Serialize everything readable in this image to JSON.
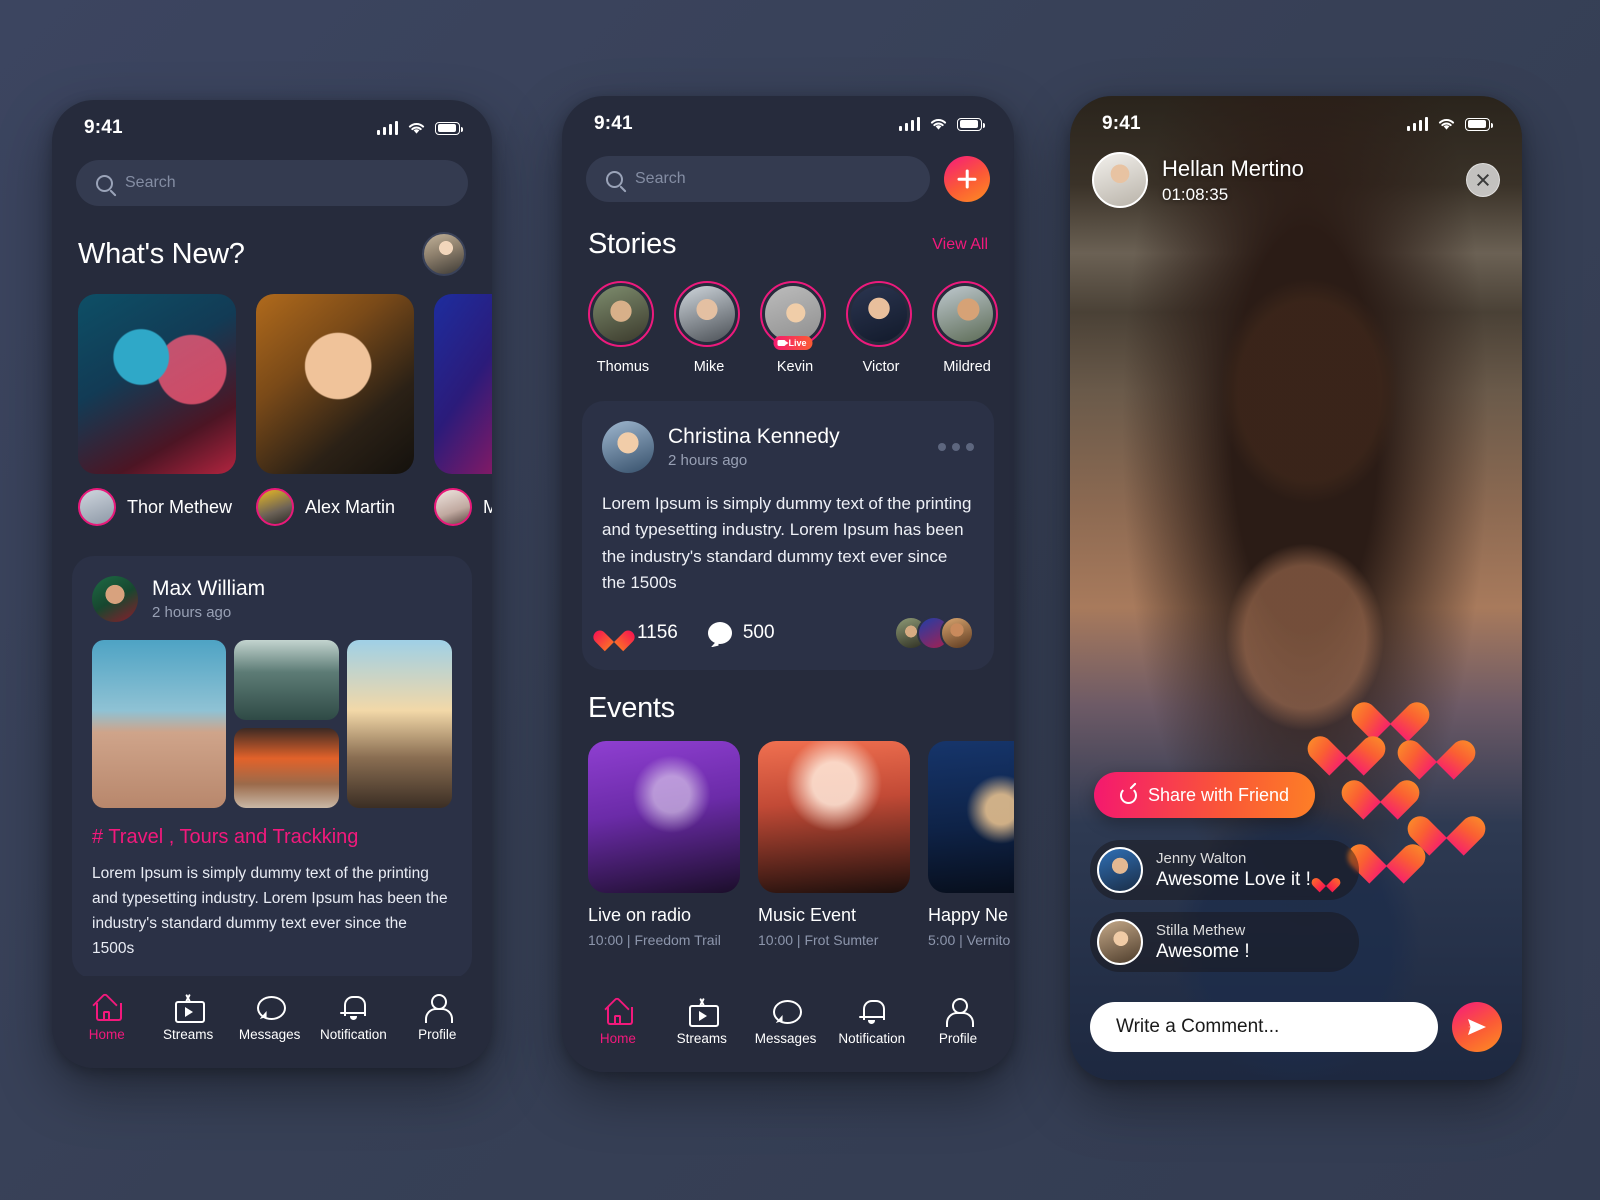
{
  "theme": {
    "page_bg": "#374056",
    "phone_bg": "#262b3c",
    "card_bg": "#2b3146",
    "accent_pink": "#f2197c",
    "accent_orange": "#fd8f22",
    "text_primary": "#ffffff",
    "text_muted": "#98a0b4"
  },
  "status_bar": {
    "time": "9:41",
    "signal_icon": "cellular-bars-icon",
    "wifi_icon": "wifi-icon",
    "battery_icon": "battery-icon"
  },
  "screen1": {
    "search": {
      "placeholder": "Search",
      "value": "",
      "icon": "search-icon"
    },
    "section_title": "What's New?",
    "profile_avatar": "user-avatar",
    "whats_new": [
      {
        "name": "Thor Methew"
      },
      {
        "name": "Alex Martin"
      },
      {
        "name": "Mon"
      }
    ],
    "post": {
      "author": "Max William",
      "time": "2 hours ago",
      "hashtag": "# Travel , Tours and Trackking",
      "body": "Lorem Ipsum is simply dummy text of the printing and typesetting industry. Lorem Ipsum has been the industry's standard dummy text ever since the 1500s",
      "photo_count": 4
    },
    "bottom_nav": [
      {
        "label": "Home",
        "icon": "home-icon",
        "active": true
      },
      {
        "label": "Streams",
        "icon": "tv-icon",
        "active": false
      },
      {
        "label": "Messages",
        "icon": "chat-icon",
        "active": false
      },
      {
        "label": "Notification",
        "icon": "bell-icon",
        "active": false
      },
      {
        "label": "Profile",
        "icon": "user-icon",
        "active": false
      }
    ]
  },
  "screen2": {
    "search": {
      "placeholder": "Search",
      "value": "",
      "icon": "search-icon"
    },
    "add_button": {
      "icon": "plus-icon",
      "label": ""
    },
    "stories_title": "Stories",
    "view_all": "View All",
    "stories": [
      {
        "name": "Thomus",
        "live": false
      },
      {
        "name": "Mike",
        "live": false
      },
      {
        "name": "Kevin",
        "live": true,
        "live_label": "Live"
      },
      {
        "name": "Victor",
        "live": false
      },
      {
        "name": "Mildred",
        "live": false
      },
      {
        "name": "",
        "live": false
      }
    ],
    "post": {
      "author": "Christina Kennedy",
      "time": "2 hours ago",
      "body": "Lorem Ipsum is simply dummy text of the printing and typesetting industry. Lorem Ipsum has been the industry's standard dummy text ever since the 1500s",
      "likes": "1156",
      "comments": "500",
      "menu_icon": "more-options-icon",
      "like_icon": "heart-icon",
      "comment_icon": "comment-bubble-icon"
    },
    "events_title": "Events",
    "events": [
      {
        "title": "Live on radio",
        "meta": "10:00 | Freedom Trail"
      },
      {
        "title": "Music Event",
        "meta": "10:00 | Frot Sumter"
      },
      {
        "title": "Happy Ne",
        "meta": "5:00 | Vernito"
      }
    ],
    "bottom_nav": [
      {
        "label": "Home",
        "icon": "home-icon",
        "active": true
      },
      {
        "label": "Streams",
        "icon": "tv-icon",
        "active": false
      },
      {
        "label": "Messages",
        "icon": "chat-icon",
        "active": false
      },
      {
        "label": "Notification",
        "icon": "bell-icon",
        "active": false
      },
      {
        "label": "Profile",
        "icon": "user-icon",
        "active": false
      }
    ]
  },
  "screen3": {
    "broadcaster": "Hellan Mertino",
    "timer": "01:08:35",
    "close_icon": "close-icon",
    "share_button": {
      "label": "Share with Friend",
      "icon": "share-icon"
    },
    "comments": [
      {
        "name": "Jenny Walton",
        "text": "Awesome Love it !",
        "has_heart": true
      },
      {
        "name": "Stilla Methew",
        "text": "Awesome !",
        "has_heart": false
      }
    ],
    "comment_input": {
      "placeholder": "Write a Comment...",
      "value": ""
    },
    "send_button": {
      "icon": "send-icon"
    },
    "floating_hearts": 6
  }
}
